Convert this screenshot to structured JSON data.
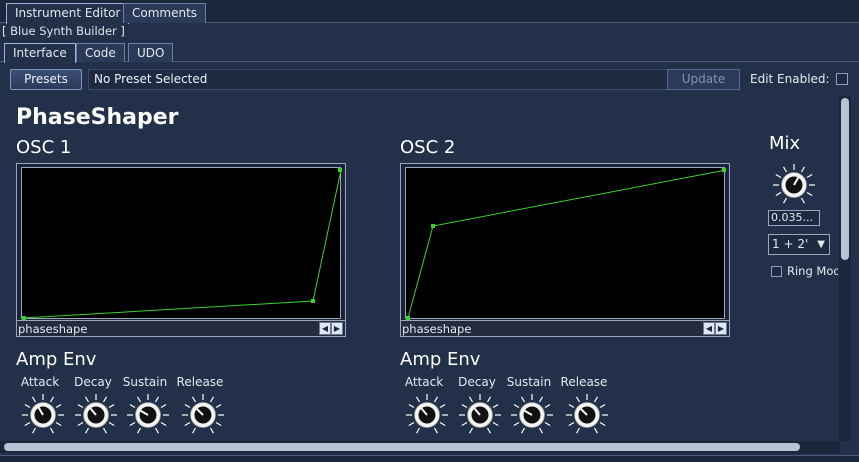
{
  "tabs": [
    "Instrument Editor",
    "Comments"
  ],
  "breadcrumb": "[ Blue Synth Builder ]",
  "subtabs": [
    "Interface",
    "Code",
    "UDO"
  ],
  "presets": {
    "button_label": "Presets",
    "current": "No Preset Selected",
    "update_label": "Update",
    "edit_label": "Edit Enabled:",
    "edit_enabled": false
  },
  "instrument_title": "PhaseShaper",
  "osc1": {
    "title": "OSC 1",
    "graph_label": "phaseshape",
    "env_title": "Amp Env",
    "knobs": [
      "Attack",
      "Decay",
      "Sustain",
      "Release"
    ]
  },
  "osc2": {
    "title": "OSC 2",
    "graph_label": "phaseshape",
    "env_title": "Amp Env",
    "knobs": [
      "Attack",
      "Decay",
      "Sustain",
      "Release"
    ]
  },
  "mix": {
    "title": "Mix",
    "value": "0.035...",
    "mode": "1 + 2'",
    "ring_mod_label": "Ring Mod",
    "ring_mod": false
  },
  "colors": {
    "background": "#223049",
    "curve": "#3cd12f",
    "canvas": "#000000"
  }
}
